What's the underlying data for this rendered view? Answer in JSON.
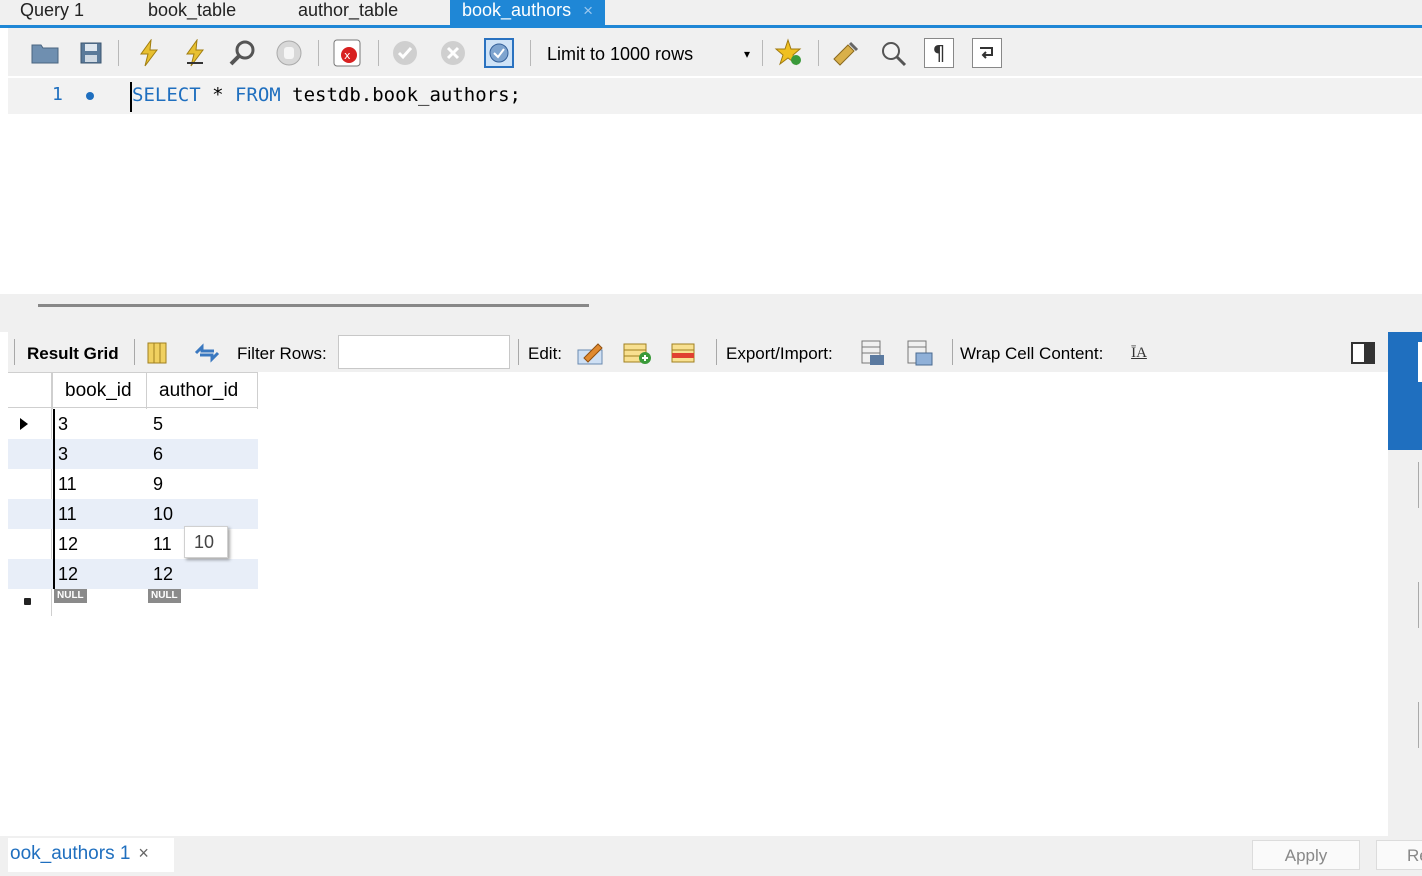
{
  "tabs": [
    "Query 1",
    "book_table",
    "author_table",
    "book_authors"
  ],
  "active_tab_close": "×",
  "toolbar": {
    "icons": [
      "open-file-icon",
      "save-icon",
      "execute-icon",
      "execute-current-icon",
      "explain-icon",
      "stop-icon",
      "toggle-error-icon",
      "commit-icon",
      "rollback-icon",
      "autocommit-icon",
      "bookmark-icon",
      "beautify-icon",
      "find-icon",
      "invisible-chars-icon",
      "wrap-icon"
    ],
    "limit_label": "Limit to 1000 rows",
    "limit_caret": "▾"
  },
  "editor": {
    "line_number": "1",
    "code_kw1": "SELECT",
    "code_star": " * ",
    "code_kw2": "FROM",
    "code_rest": " testdb.book_authors;"
  },
  "result_toolbar": {
    "result_grid": "Result Grid",
    "filter_rows": "Filter Rows:",
    "filter_value": "",
    "edit": "Edit:",
    "export_import": "Export/Import:",
    "wrap": "Wrap Cell Content:"
  },
  "grid": {
    "columns": [
      "book_id",
      "author_id"
    ],
    "rows": [
      [
        "3",
        "5"
      ],
      [
        "3",
        "6"
      ],
      [
        "11",
        "9"
      ],
      [
        "11",
        "10"
      ],
      [
        "12",
        "11"
      ],
      [
        "12",
        "12"
      ]
    ],
    "null_label": "NULL",
    "tooltip": "10"
  },
  "bottom": {
    "result_tab": "ook_authors 1",
    "close": "×",
    "apply": "Apply",
    "revert": "Re"
  }
}
